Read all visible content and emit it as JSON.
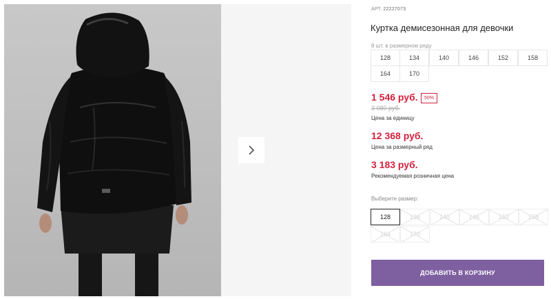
{
  "gallery": {
    "next_icon": "chevron-right-icon"
  },
  "product": {
    "article_label": "АРТ.",
    "article_number": "22227073",
    "title": "Куртка демисезонная для девочки",
    "sizes_count_text": "8 шт. в размерном ряду",
    "size_row": [
      "128",
      "134",
      "140",
      "146",
      "152",
      "158",
      "164",
      "170"
    ],
    "price_unit": "1 546 руб.",
    "discount_badge": "50%",
    "price_old": "3 080 руб.",
    "price_unit_label": "Цена за единицу",
    "price_row": "12 368 руб.",
    "price_row_label": "Цена за размерный ряд",
    "price_retail": "3 183 руб.",
    "price_retail_label": "Рекомендуемая розничная цена",
    "choose_size_label": "Выберите размер:",
    "pick_sizes": [
      "128",
      "134",
      "140",
      "146",
      "152",
      "158",
      "164",
      "170"
    ],
    "selected_size": "128",
    "add_to_cart": "ДОБАВИТЬ В КОРЗИНУ"
  },
  "colors": {
    "price_red": "#d4213d",
    "button_purple": "#7e5fa0"
  }
}
